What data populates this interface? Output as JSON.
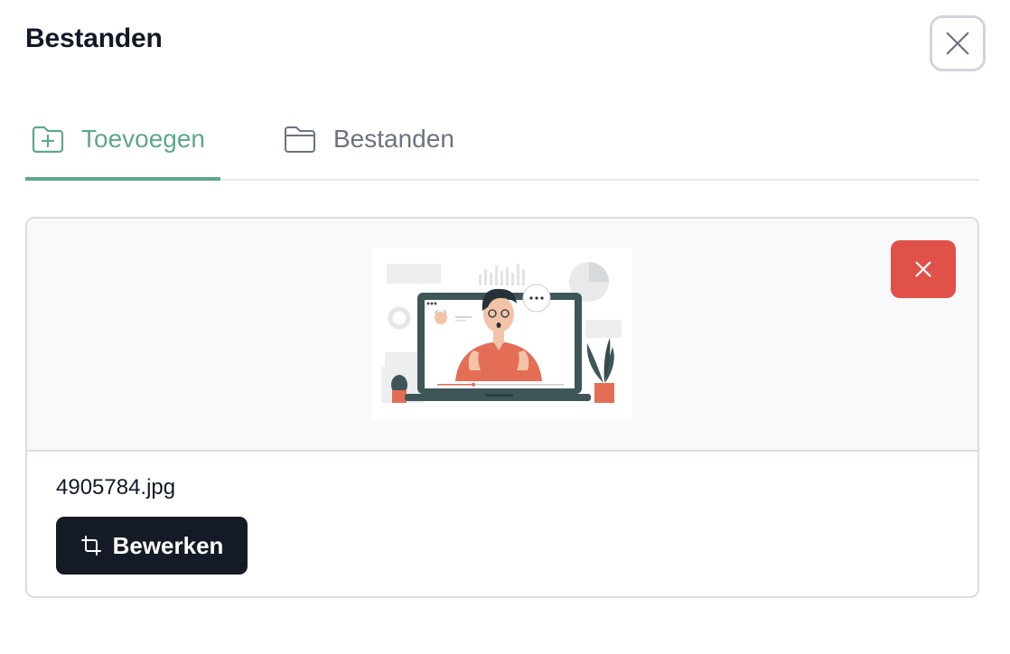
{
  "dialog": {
    "title": "Bestanden"
  },
  "tabs": [
    {
      "label": "Toevoegen",
      "icon": "folder-plus-icon",
      "active": true
    },
    {
      "label": "Bestanden",
      "icon": "folder-icon",
      "active": false
    }
  ],
  "file": {
    "name": "4905784.jpg",
    "edit_label": "Bewerken",
    "edit_icon": "crop-icon",
    "remove_icon": "close-icon"
  },
  "colors": {
    "accent": "#5ea88a",
    "danger": "#e0514a",
    "dark_button": "#151b26",
    "inactive_tab": "#6b7280"
  }
}
